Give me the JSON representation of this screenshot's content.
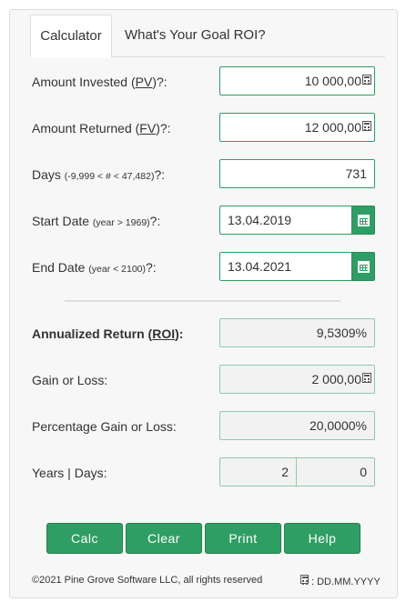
{
  "tabs": [
    {
      "label": "Calculator",
      "active": true
    },
    {
      "label": "What's Your Goal ROI?",
      "active": false
    }
  ],
  "inputs": {
    "amount_invested": {
      "label_prefix": "Amount Invested (",
      "label_key": "PV",
      "label_suffix": ")?:",
      "value": "10 000,00"
    },
    "amount_returned": {
      "label_prefix": "Amount Returned (",
      "label_key": "FV",
      "label_suffix": ")?:",
      "value": "12 000,00"
    },
    "days": {
      "label_main": "Days ",
      "label_small": "(-9,999 < # < 47,482)",
      "label_suffix": "?:",
      "value": "731"
    },
    "start_date": {
      "label_main": "Start Date ",
      "label_small": "(year > 1969)",
      "label_suffix": "?:",
      "value": "13.04.2019"
    },
    "end_date": {
      "label_main": "End Date ",
      "label_small": "(year < 2100)",
      "label_suffix": "?:",
      "value": "13.04.2021"
    }
  },
  "results": {
    "annualized_return": {
      "label_prefix": "Annualized Return (",
      "label_key": "ROI",
      "label_suffix": "):",
      "value": "9,5309%"
    },
    "gain_or_loss": {
      "label": "Gain or Loss:",
      "value": "2 000,00"
    },
    "percentage_gain": {
      "label": "Percentage Gain or Loss:",
      "value": "20,0000%"
    },
    "years_days": {
      "label": "Years | Days:",
      "years": "2",
      "days": "0"
    }
  },
  "buttons": {
    "calc": "Calc",
    "clear": "Clear",
    "print": "Print",
    "help": "Help"
  },
  "footer": {
    "copyright": "©2021 Pine Grove Software LLC, all rights reserved",
    "date_format": ": DD.MM.YYYY"
  },
  "colors": {
    "accent": "#2f9e64",
    "panel_bg": "#f7f7f7",
    "readonly_bg": "#f2f2f2"
  }
}
